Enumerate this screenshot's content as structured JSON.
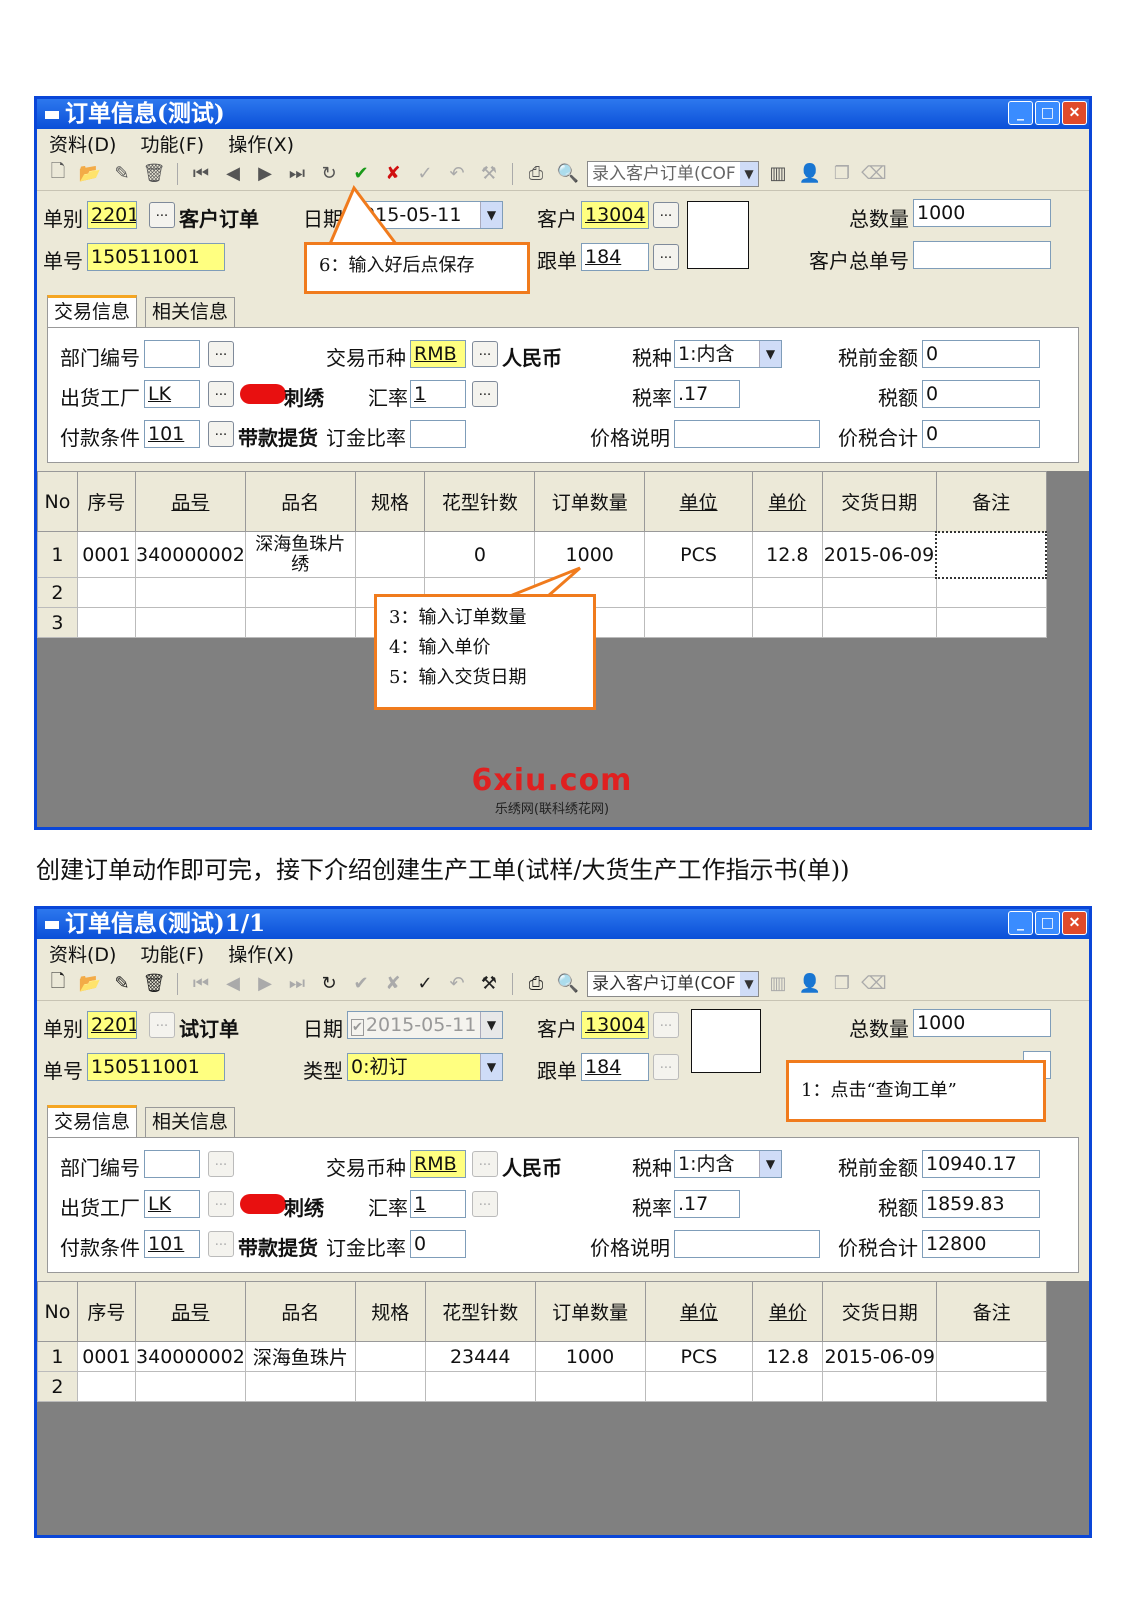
{
  "window1": {
    "title": "订单信息(测试)",
    "menu": [
      "资料(D)",
      "功能(F)",
      "操作(X)"
    ],
    "toolbar_combo": "录入客户订单(COF",
    "header": {
      "type_label": "单别",
      "type_value": "2201",
      "type_name": "客户订单",
      "date_label": "日期",
      "date_value": "2015-05-11",
      "customer_label": "客户",
      "customer_value": "13004",
      "total_qty_label": "总数量",
      "total_qty_value": "1000",
      "order_no_label": "单号",
      "order_no_value": "150511001",
      "follow_label": "跟单",
      "follow_value": "184",
      "cust_total_no_label": "客户总单号",
      "cust_total_no_value": ""
    },
    "tabs": [
      "交易信息",
      "相关信息"
    ],
    "panel": {
      "dept_label": "部门编号",
      "dept_value": "",
      "currency_label": "交易币种",
      "currency_value": "RMB",
      "currency_name": "人民币",
      "taxtype_label": "税种",
      "taxtype_value": "1:内含",
      "pretax_label": "税前金额",
      "pretax_value": "0",
      "factory_label": "出货工厂",
      "factory_value": "LK",
      "factory_name": "刺绣",
      "rate_label": "汇率",
      "rate_value": "1",
      "taxrate_label": "税率",
      "taxrate_value": ".17",
      "tax_label": "税额",
      "tax_value": "0",
      "payterm_label": "付款条件",
      "payterm_value": "101",
      "payterm_name": "带款提货",
      "deposit_label": "订金比率",
      "deposit_value": "",
      "price_note_label": "价格说明",
      "price_note_value": "",
      "total_label": "价税合计",
      "total_value": "0"
    },
    "grid": {
      "columns": [
        "No",
        "序号",
        "品号",
        "品名",
        "规格",
        "花型针数",
        "订单数量",
        "单位",
        "单价",
        "交货日期",
        "备注"
      ],
      "rows": [
        [
          "1",
          "0001",
          "340000002",
          "深海鱼珠片\n绣",
          "",
          "0",
          "1000",
          "PCS",
          "12.8",
          "2015-06-09",
          ""
        ],
        [
          "2",
          "",
          "",
          "",
          "",
          "",
          "",
          "",
          "",
          "",
          ""
        ],
        [
          "3",
          "",
          "",
          "",
          "",
          "",
          "",
          "",
          "",
          "",
          ""
        ]
      ]
    },
    "callout_save": "6：输入好后点保存",
    "callout_steps": [
      "3：输入订单数量",
      "4：输入单价",
      "5：输入交货日期"
    ],
    "watermark_main": "6xiu.com",
    "watermark_sub": "乐绣网(联科绣花网)"
  },
  "caption": "创建订单动作即可完，接下介绍创建生产工单(试样/大货生产工作指示书(单))",
  "window2": {
    "title": "订单信息(测试)1/1",
    "menu": [
      "资料(D)",
      "功能(F)",
      "操作(X)"
    ],
    "toolbar_combo": "录入客户订单(COF",
    "header": {
      "type_label": "单别",
      "type_value": "2201",
      "type_name": "试订单",
      "date_label": "日期",
      "date_value": "2015-05-11",
      "customer_label": "客户",
      "customer_value": "13004",
      "total_qty_label": "总数量",
      "total_qty_value": "1000",
      "order_no_label": "单号",
      "order_no_value": "150511001",
      "kind_label": "类型",
      "kind_value": "0:初订",
      "follow_label": "跟单",
      "follow_value": "184"
    },
    "tabs": [
      "交易信息",
      "相关信息"
    ],
    "panel": {
      "dept_label": "部门编号",
      "dept_value": "",
      "currency_label": "交易币种",
      "currency_value": "RMB",
      "currency_name": "人民币",
      "taxtype_label": "税种",
      "taxtype_value": "1:内含",
      "pretax_label": "税前金额",
      "pretax_value": "10940.17",
      "factory_label": "出货工厂",
      "factory_value": "LK",
      "factory_name": "刺绣",
      "rate_label": "汇率",
      "rate_value": "1",
      "taxrate_label": "税率",
      "taxrate_value": ".17",
      "tax_label": "税额",
      "tax_value": "1859.83",
      "payterm_label": "付款条件",
      "payterm_value": "101",
      "payterm_name": "带款提货",
      "deposit_label": "订金比率",
      "deposit_value": "0",
      "price_note_label": "价格说明",
      "price_note_value": "",
      "total_label": "价税合计",
      "total_value": "12800"
    },
    "grid": {
      "columns": [
        "No",
        "序号",
        "品号",
        "品名",
        "规格",
        "花型针数",
        "订单数量",
        "单位",
        "单价",
        "交货日期",
        "备注"
      ],
      "rows": [
        [
          "1",
          "0001",
          "340000002",
          "深海鱼珠片",
          "",
          "23444",
          "1000",
          "PCS",
          "12.8",
          "2015-06-09",
          ""
        ],
        [
          "2",
          "",
          "",
          "",
          "",
          "",
          "",
          "",
          "",
          "",
          ""
        ]
      ]
    },
    "callout_query": "1：点击“查询工单”"
  }
}
